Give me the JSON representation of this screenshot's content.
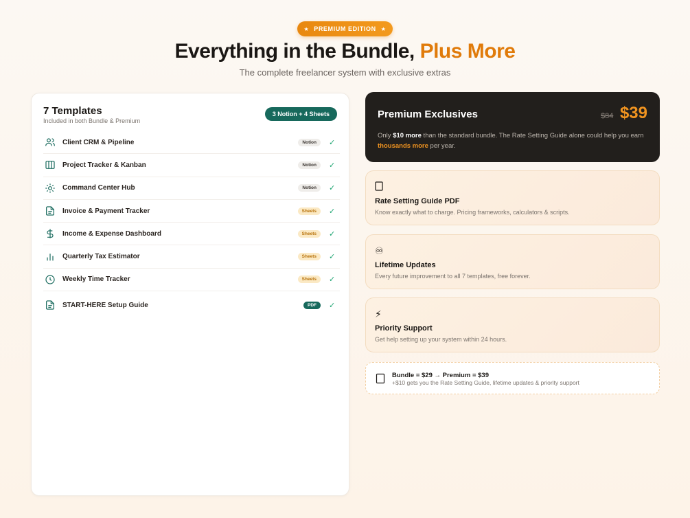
{
  "header": {
    "badge": "PREMIUM EDITION",
    "badge_star": "★",
    "title_main": "Everything in the Bundle,",
    "title_accent": "Plus More",
    "subtitle": "The complete freelancer system with exclusive extras"
  },
  "templates": {
    "title": "7 Templates",
    "subtitle": "Included in both Bundle & Premium",
    "pill": "3 Notion + 4 Sheets",
    "items": [
      {
        "name": "Client CRM & Pipeline",
        "tag": "Notion",
        "icon": "users-icon"
      },
      {
        "name": "Project Tracker & Kanban",
        "tag": "Notion",
        "icon": "columns-icon"
      },
      {
        "name": "Command Center Hub",
        "tag": "Notion",
        "icon": "sun-icon"
      },
      {
        "name": "Invoice & Payment Tracker",
        "tag": "Sheets",
        "icon": "file-icon"
      },
      {
        "name": "Income & Expense Dashboard",
        "tag": "Sheets",
        "icon": "dollar-icon"
      },
      {
        "name": "Quarterly Tax Estimator",
        "tag": "Sheets",
        "icon": "bar-chart-icon"
      },
      {
        "name": "Weekly Time Tracker",
        "tag": "Sheets",
        "icon": "clock-icon"
      },
      {
        "name": "START-HERE Setup Guide",
        "tag": "PDF",
        "icon": "file-icon"
      }
    ],
    "check": "✓"
  },
  "premium": {
    "title": "Premium Exclusives",
    "old_price": "$84",
    "new_price": "$39",
    "text_pre": "Only ",
    "text_bold": "$10 more",
    "text_mid": " than the standard bundle. The Rate Setting Guide alone could help you earn ",
    "text_hl": "thousands more",
    "text_post": " per year."
  },
  "features": [
    {
      "icon": "book-icon",
      "title": "Rate Setting Guide PDF",
      "desc": "Know exactly what to charge. Pricing frameworks, calculators & scripts."
    },
    {
      "icon": "infinity-icon",
      "glyph": "♾",
      "title": "Lifetime Updates",
      "desc": "Every future improvement to all 7 templates, free forever."
    },
    {
      "icon": "lightning-icon",
      "glyph": "⚡",
      "title": "Priority Support",
      "desc": "Get help setting up your system within 24 hours."
    }
  ],
  "bundle": {
    "title": "Bundle = $29  →  Premium = $39",
    "desc": "+$10 gets you the Rate Setting Guide, lifetime updates & priority support"
  },
  "colors": {
    "accent": "#e07b0a",
    "teal": "#17695c",
    "dark": "#221f1c"
  }
}
